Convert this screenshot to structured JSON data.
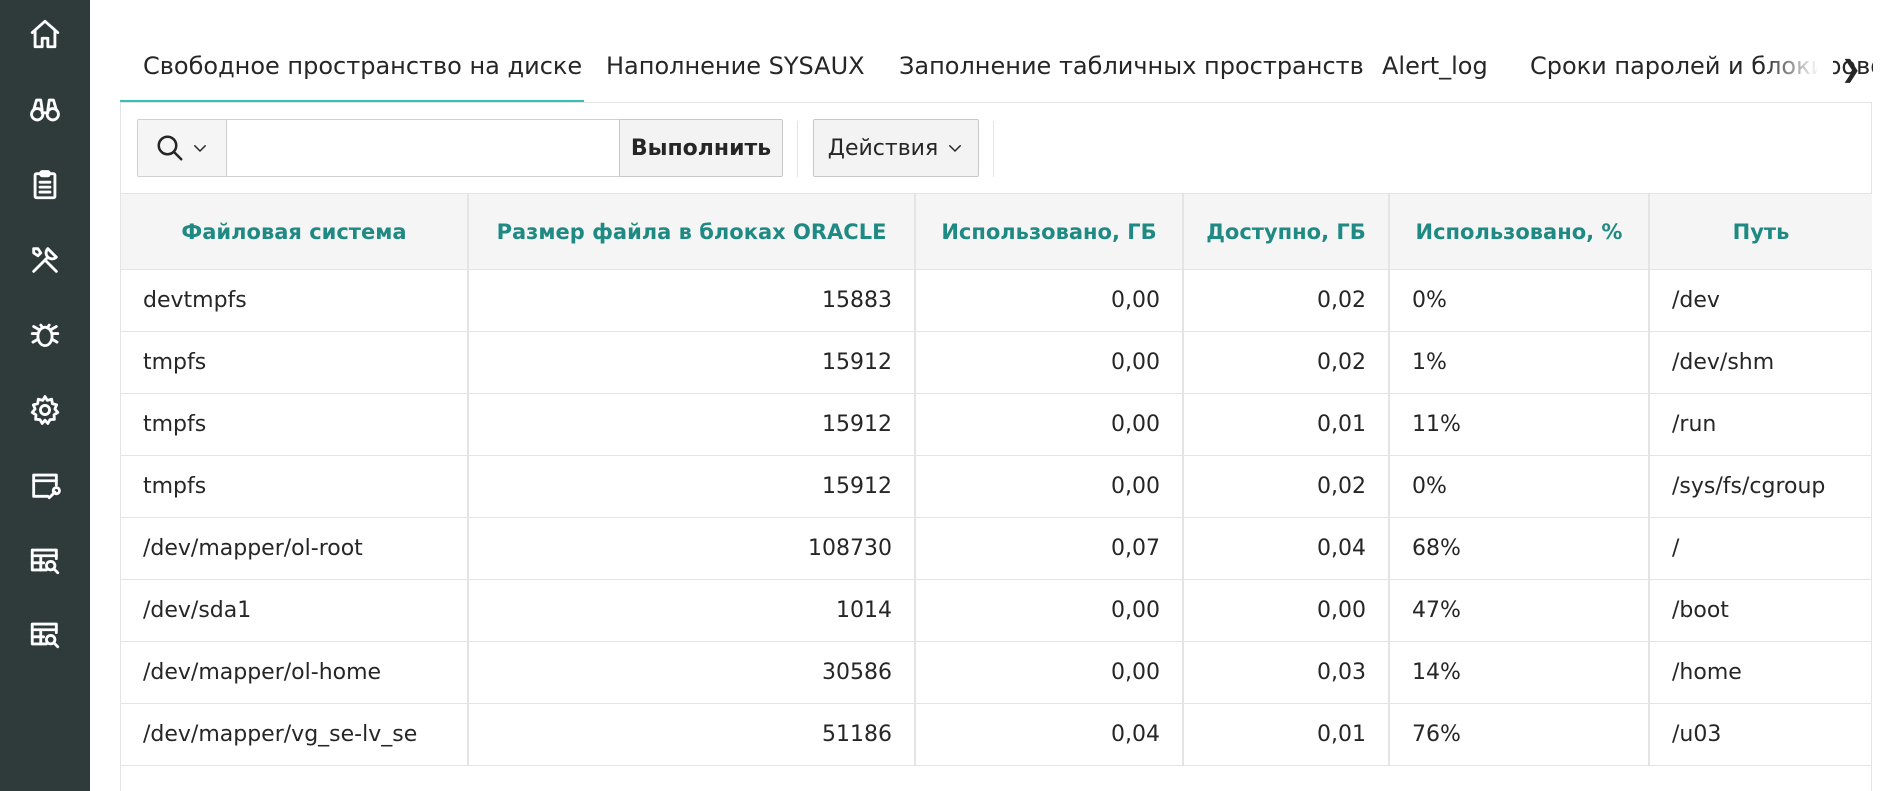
{
  "sidebar": {
    "items": [
      {
        "icon": "home-icon"
      },
      {
        "icon": "binoculars-icon"
      },
      {
        "icon": "clipboard-icon"
      },
      {
        "icon": "tools-icon"
      },
      {
        "icon": "bug-icon"
      },
      {
        "icon": "gear-icon"
      },
      {
        "icon": "window-wrench-icon"
      },
      {
        "icon": "table-search-icon"
      },
      {
        "icon": "table-search-icon"
      }
    ]
  },
  "tabs": [
    {
      "label": "Свободное пространство на диске",
      "active": true
    },
    {
      "label": "Наполнение SYSAUX",
      "active": false
    },
    {
      "label": "Заполнение табличных пространств",
      "active": false
    },
    {
      "label": "Alert_log",
      "active": false
    },
    {
      "label": "Сроки паролей и блокировок",
      "active": false
    }
  ],
  "tab_scroll_label": "❯",
  "toolbar": {
    "search_value": "",
    "run_label": "Выполнить",
    "actions_label": "Действия"
  },
  "table": {
    "columns": [
      "Файловая система",
      "Размер файла в блоках ORACLE",
      "Использовано, ГБ",
      "Доступно, ГБ",
      "Использовано, %",
      "Путь"
    ],
    "rows": [
      [
        "devtmpfs",
        "15883",
        "0,00",
        "0,02",
        "0%",
        "/dev"
      ],
      [
        "tmpfs",
        "15912",
        "0,00",
        "0,02",
        "1%",
        "/dev/shm"
      ],
      [
        "tmpfs",
        "15912",
        "0,00",
        "0,01",
        "11%",
        "/run"
      ],
      [
        "tmpfs",
        "15912",
        "0,00",
        "0,02",
        "0%",
        "/sys/fs/cgroup"
      ],
      [
        "/dev/mapper/ol-root",
        "108730",
        "0,07",
        "0,04",
        "68%",
        "/"
      ],
      [
        "/dev/sda1",
        "1014",
        "0,00",
        "0,00",
        "47%",
        "/boot"
      ],
      [
        "/dev/mapper/ol-home",
        "30586",
        "0,00",
        "0,03",
        "14%",
        "/home"
      ],
      [
        "/dev/mapper/vg_se-lv_se",
        "51186",
        "0,04",
        "0,01",
        "76%",
        "/u03"
      ]
    ]
  },
  "colors": {
    "sidebar_bg": "#2f3b3b",
    "accent_tab_underline": "#35c0b5",
    "header_text": "#1f8a83"
  }
}
